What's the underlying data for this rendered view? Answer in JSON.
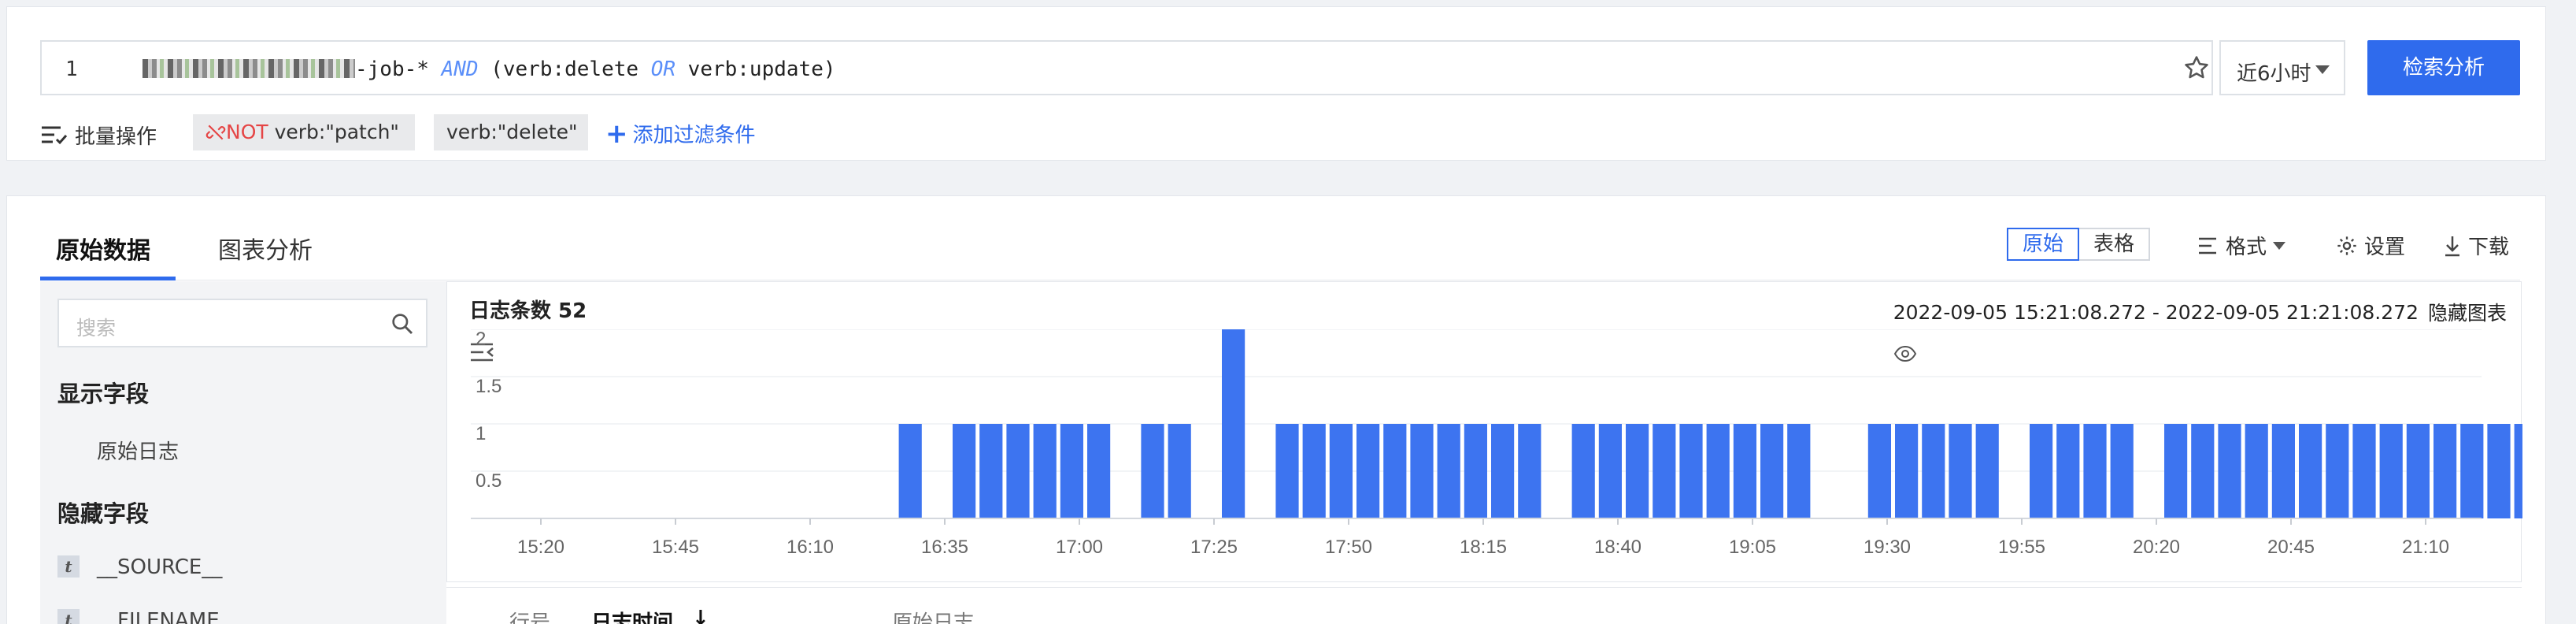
{
  "query": {
    "line_number": "1",
    "text_suffix": "-job-* ",
    "and_keyword": "AND",
    "part2": " (verb:delete ",
    "or_keyword": "OR",
    "part3": " verb:update)",
    "time_range": "近6小时",
    "search_button": "检索分析"
  },
  "filters": {
    "bulk_label": "批量操作",
    "chip1_not": "NOT",
    "chip1_text": " verb:\"patch\"",
    "chip2_text": "verb:\"delete\"",
    "add_filter": "添加过滤条件"
  },
  "tabs": {
    "raw": "原始数据",
    "chart": "图表分析"
  },
  "toolbar": {
    "view_raw": "原始",
    "view_table": "表格",
    "format": "格式",
    "settings": "设置",
    "download": "下载"
  },
  "sidebar": {
    "search_placeholder": "搜索",
    "shown_heading": "显示字段",
    "shown_items": [
      "原始日志"
    ],
    "hidden_heading": "隐藏字段",
    "hidden_items": [
      {
        "badge": "t",
        "name": "__SOURCE__"
      },
      {
        "badge": "t",
        "name": "__FILENAME__"
      }
    ]
  },
  "histogram": {
    "count_label": "日志条数 52",
    "range": "2022-09-05 15:21:08.272 - 2022-09-05 21:21:08.272",
    "hide_chart": "隐藏图表"
  },
  "table": {
    "col_line": "行号",
    "col_time": "日志时间",
    "col_log": "原始日志"
  },
  "colors": {
    "accent": "#2f6bed",
    "bar": "#3d74f0",
    "not": "#e54545"
  },
  "chart_data": {
    "type": "bar",
    "x_ticks": [
      "15:20",
      "15:45",
      "16:10",
      "16:35",
      "17:00",
      "17:25",
      "17:50",
      "18:15",
      "18:40",
      "19:05",
      "19:30",
      "19:55",
      "20:20",
      "20:45",
      "21:10"
    ],
    "y_ticks": [
      "2",
      "1.5",
      "1",
      "0.5"
    ],
    "ylim": [
      0,
      2
    ],
    "bins_per_tick": 5,
    "values": [
      0,
      0,
      0,
      0,
      0,
      0,
      0,
      0,
      0,
      0,
      0,
      0,
      0,
      0,
      0,
      1,
      0,
      1,
      1,
      1,
      1,
      1,
      1,
      0,
      1,
      1,
      0,
      2,
      0,
      1,
      1,
      1,
      1,
      1,
      1,
      1,
      1,
      1,
      1,
      0,
      1,
      1,
      1,
      1,
      1,
      1,
      1,
      1,
      1,
      0,
      0,
      1,
      1,
      1,
      1,
      1,
      0,
      1,
      1,
      1,
      1,
      0,
      1,
      1,
      1,
      1,
      1,
      1,
      1,
      1,
      1,
      1,
      1,
      1,
      1,
      1,
      1,
      1
    ]
  }
}
